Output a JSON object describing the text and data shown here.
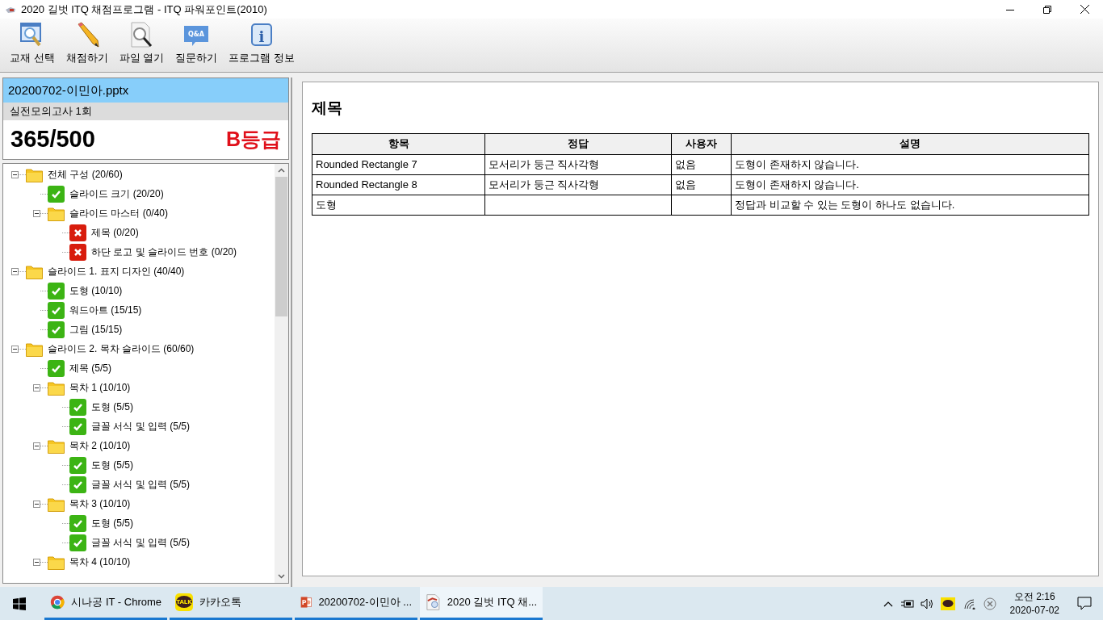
{
  "window": {
    "title": "2020 길벗 ITQ 채점프로그램 - ITQ 파워포인트(2010)"
  },
  "toolbar": [
    {
      "kind": "book",
      "label": "교재 선택"
    },
    {
      "kind": "pencil",
      "label": "채점하기"
    },
    {
      "kind": "open",
      "label": "파일 열기"
    },
    {
      "kind": "qa",
      "label": "질문하기",
      "icon_text": "Q&A"
    },
    {
      "kind": "info",
      "label": "프로그램 정보",
      "icon_text": "i"
    }
  ],
  "result": {
    "file": "20200702-이민아.pptx",
    "exam": "실전모의고사 1회",
    "score": "365/500",
    "grade": "B등급"
  },
  "tree": [
    {
      "kind": "folder",
      "label": "전체 구성 (20/60)",
      "expanded": true,
      "children": [
        {
          "kind": "pass",
          "label": "슬라이드 크기 (20/20)"
        },
        {
          "kind": "folder",
          "label": "슬라이드 마스터 (0/40)",
          "expanded": true,
          "children": [
            {
              "kind": "fail",
              "label": "제목 (0/20)"
            },
            {
              "kind": "fail",
              "label": "하단 로고 및 슬라이드 번호 (0/20)"
            }
          ]
        }
      ]
    },
    {
      "kind": "folder",
      "label": "슬라이드 1. 표지 디자인 (40/40)",
      "expanded": true,
      "children": [
        {
          "kind": "pass",
          "label": "도형 (10/10)"
        },
        {
          "kind": "pass",
          "label": "워드아트 (15/15)"
        },
        {
          "kind": "pass",
          "label": "그림 (15/15)"
        }
      ]
    },
    {
      "kind": "folder",
      "label": "슬라이드 2. 목차 슬라이드 (60/60)",
      "expanded": true,
      "children": [
        {
          "kind": "pass",
          "label": "제목 (5/5)"
        },
        {
          "kind": "folder",
          "label": "목차 1 (10/10)",
          "expanded": true,
          "children": [
            {
              "kind": "pass",
              "label": "도형 (5/5)"
            },
            {
              "kind": "pass",
              "label": "글꼴 서식 및 입력 (5/5)"
            }
          ]
        },
        {
          "kind": "folder",
          "label": "목차 2 (10/10)",
          "expanded": true,
          "children": [
            {
              "kind": "pass",
              "label": "도형 (5/5)"
            },
            {
              "kind": "pass",
              "label": "글꼴 서식 및 입력 (5/5)"
            }
          ]
        },
        {
          "kind": "folder",
          "label": "목차 3 (10/10)",
          "expanded": true,
          "children": [
            {
              "kind": "pass",
              "label": "도형 (5/5)"
            },
            {
              "kind": "pass",
              "label": "글꼴 서식 및 입력 (5/5)"
            }
          ]
        },
        {
          "kind": "folder",
          "label": "목차 4 (10/10)",
          "expanded": true
        }
      ]
    }
  ],
  "detail": {
    "title": "제목",
    "columns": [
      "항목",
      "정답",
      "사용자",
      "설명"
    ],
    "rows": [
      [
        "Rounded Rectangle 7",
        "모서리가 둥근 직사각형",
        "없음",
        "도형이 존재하지 않습니다."
      ],
      [
        "Rounded Rectangle 8",
        "모서리가 둥근 직사각형",
        "없음",
        "도형이 존재하지 않습니다."
      ],
      [
        "도형",
        "",
        "",
        "정답과 비교할 수 있는 도형이 하나도 없습니다."
      ]
    ]
  },
  "taskbar": {
    "apps": [
      {
        "kind": "chrome",
        "label": "시나공 IT - Chrome",
        "selected": false
      },
      {
        "kind": "kakao",
        "label": "카카오톡",
        "selected": false,
        "icon_text": "TALK"
      },
      {
        "kind": "ppt",
        "label": "20200702-이민아 ...",
        "selected": false,
        "icon_text": "P"
      },
      {
        "kind": "itq",
        "label": "2020 길벗 ITQ 채...",
        "selected": true
      }
    ],
    "time": "오전 2:16",
    "date": "2020-07-02"
  }
}
